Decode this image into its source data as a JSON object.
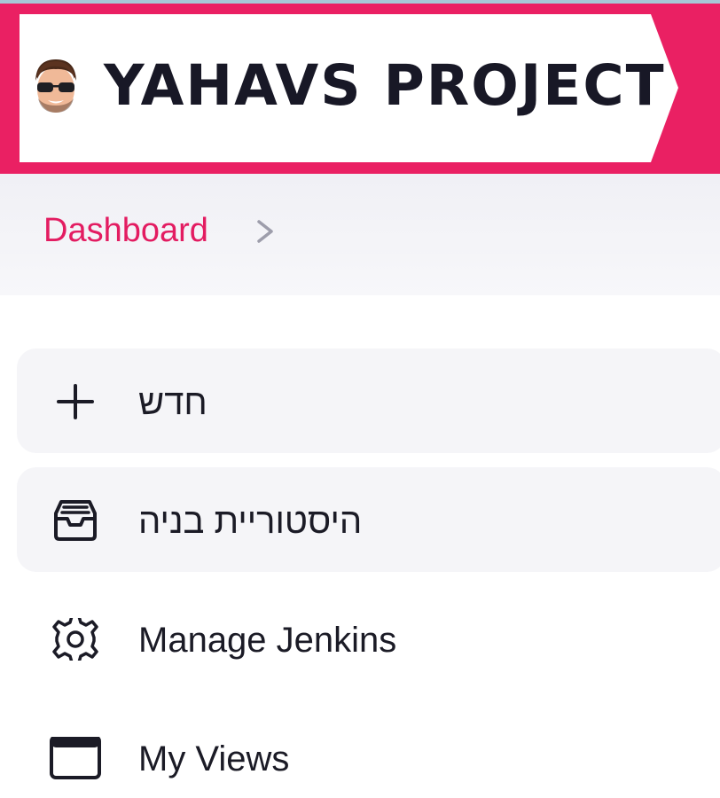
{
  "header": {
    "title": "YAHAVS PROJECT",
    "brand_color": "#ea2063",
    "avatar_icon": "memoji-avatar-sunglasses"
  },
  "breadcrumb": {
    "items": [
      {
        "label": "Dashboard"
      }
    ],
    "link_color": "#e31c61"
  },
  "tasks": [
    {
      "label": "חדש",
      "icon": "plus-icon"
    },
    {
      "label": "היסטוריית בניה",
      "icon": "inbox-tray-icon"
    },
    {
      "label": "Manage Jenkins",
      "icon": "gear-icon"
    },
    {
      "label": "My Views",
      "icon": "window-icon"
    }
  ]
}
